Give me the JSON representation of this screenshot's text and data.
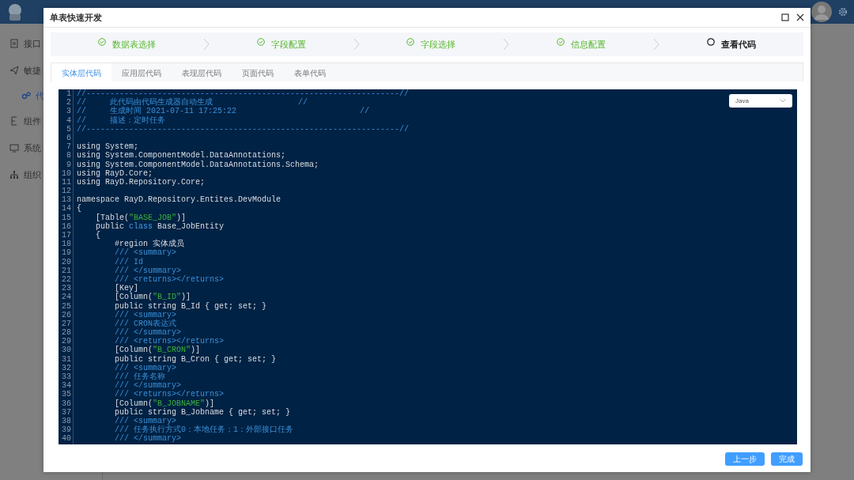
{
  "sidebar": {
    "items": [
      {
        "label": "接口",
        "kind": "top",
        "selected": false
      },
      {
        "label": "敏捷",
        "kind": "top",
        "selected": false
      },
      {
        "label": "代",
        "kind": "sub",
        "selected": true
      },
      {
        "label": "组件",
        "kind": "top",
        "selected": false
      },
      {
        "label": "系统",
        "kind": "top",
        "selected": false
      },
      {
        "label": "组织",
        "kind": "top",
        "selected": false
      }
    ]
  },
  "dialog": {
    "title": "单表快速开发",
    "steps": [
      {
        "label": "数据表选择",
        "done": true
      },
      {
        "label": "字段配置",
        "done": true
      },
      {
        "label": "字段选择",
        "done": true
      },
      {
        "label": "信息配置",
        "done": true
      },
      {
        "label": "查看代码",
        "done": false
      }
    ],
    "tabs": [
      {
        "label": "实体层代码",
        "selected": true
      },
      {
        "label": "应用层代码",
        "selected": false
      },
      {
        "label": "表现层代码",
        "selected": false
      },
      {
        "label": "页面代码",
        "selected": false
      },
      {
        "label": "表单代码",
        "selected": false
      }
    ],
    "language_select": {
      "value": "Java"
    },
    "code_lines": [
      {
        "number": "1",
        "tokens": [
          {
            "kind": "comment",
            "text": "//------------------------------------------------------------------//"
          }
        ]
      },
      {
        "number": "2",
        "tokens": [
          {
            "kind": "comment",
            "text": "//     此代码由代码生成器自动生成                  //"
          }
        ]
      },
      {
        "number": "3",
        "tokens": [
          {
            "kind": "comment",
            "text": "//     生成时间 2021-07-11 17:25:22                          //"
          }
        ]
      },
      {
        "number": "4",
        "tokens": [
          {
            "kind": "comment",
            "text": "//     描述：定时任务"
          }
        ]
      },
      {
        "number": "5",
        "tokens": [
          {
            "kind": "comment",
            "text": "//------------------------------------------------------------------//"
          }
        ]
      },
      {
        "number": "6"
      },
      {
        "number": "7",
        "tokens": [
          {
            "kind": "code",
            "text": "using System;"
          }
        ]
      },
      {
        "number": "8",
        "tokens": [
          {
            "kind": "code",
            "text": "using System.ComponentModel.DataAnnotations;"
          }
        ]
      },
      {
        "number": "9",
        "tokens": [
          {
            "kind": "code",
            "text": "using System.ComponentModel.DataAnnotations.Schema;"
          }
        ]
      },
      {
        "number": "10",
        "tokens": [
          {
            "kind": "code",
            "text": "using RayD.Core;"
          }
        ]
      },
      {
        "number": "11",
        "tokens": [
          {
            "kind": "code",
            "text": "using RayD.Repository.Core;"
          }
        ]
      },
      {
        "number": "12"
      },
      {
        "number": "13",
        "tokens": [
          {
            "kind": "code",
            "text": "namespace RayD.Repository.Entites.DevModule"
          }
        ]
      },
      {
        "number": "14",
        "tokens": [
          {
            "kind": "code",
            "text": "{"
          }
        ]
      },
      {
        "number": "15",
        "tokens": [
          {
            "kind": "code",
            "text": "    [Table("
          },
          {
            "kind": "string",
            "text": "\"BASE_JOB\""
          },
          {
            "kind": "code",
            "text": ")]"
          }
        ]
      },
      {
        "number": "16",
        "tokens": [
          {
            "kind": "code",
            "text": "    public "
          },
          {
            "kind": "keyword",
            "text": "class"
          },
          {
            "kind": "code",
            "text": " Base_JobEntity"
          }
        ]
      },
      {
        "number": "17",
        "tokens": [
          {
            "kind": "code",
            "text": "    {"
          }
        ]
      },
      {
        "number": "18",
        "tokens": [
          {
            "kind": "code",
            "text": "        #region 实体成员"
          }
        ]
      },
      {
        "number": "19",
        "tokens": [
          {
            "kind": "comment",
            "text": "        /// <summary>"
          }
        ]
      },
      {
        "number": "20",
        "tokens": [
          {
            "kind": "comment",
            "text": "        /// Id"
          }
        ]
      },
      {
        "number": "21",
        "tokens": [
          {
            "kind": "comment",
            "text": "        /// </summary>"
          }
        ]
      },
      {
        "number": "22",
        "tokens": [
          {
            "kind": "comment",
            "text": "        /// <returns></returns>"
          }
        ]
      },
      {
        "number": "23",
        "tokens": [
          {
            "kind": "code",
            "text": "        [Key]"
          }
        ]
      },
      {
        "number": "24",
        "tokens": [
          {
            "kind": "code",
            "text": "        [Column("
          },
          {
            "kind": "string",
            "text": "\"B_ID\""
          },
          {
            "kind": "code",
            "text": ")]"
          }
        ]
      },
      {
        "number": "25",
        "tokens": [
          {
            "kind": "code",
            "text": "        public string B_Id { get; set; }"
          }
        ]
      },
      {
        "number": "26",
        "tokens": [
          {
            "kind": "comment",
            "text": "        /// <summary>"
          }
        ]
      },
      {
        "number": "27",
        "tokens": [
          {
            "kind": "comment",
            "text": "        /// CRON表达式"
          }
        ]
      },
      {
        "number": "28",
        "tokens": [
          {
            "kind": "comment",
            "text": "        /// </summary>"
          }
        ]
      },
      {
        "number": "29",
        "tokens": [
          {
            "kind": "comment",
            "text": "        /// <returns></returns>"
          }
        ]
      },
      {
        "number": "30",
        "tokens": [
          {
            "kind": "code",
            "text": "        [Column("
          },
          {
            "kind": "string",
            "text": "\"B_CRON\""
          },
          {
            "kind": "code",
            "text": ")]"
          }
        ]
      },
      {
        "number": "31",
        "tokens": [
          {
            "kind": "code",
            "text": "        public string B_Cron { get; set; }"
          }
        ]
      },
      {
        "number": "32",
        "tokens": [
          {
            "kind": "comment",
            "text": "        /// <summary>"
          }
        ]
      },
      {
        "number": "33",
        "tokens": [
          {
            "kind": "comment",
            "text": "        /// 任务名称"
          }
        ]
      },
      {
        "number": "34",
        "tokens": [
          {
            "kind": "comment",
            "text": "        /// </summary>"
          }
        ]
      },
      {
        "number": "35",
        "tokens": [
          {
            "kind": "comment",
            "text": "        /// <returns></returns>"
          }
        ]
      },
      {
        "number": "36",
        "tokens": [
          {
            "kind": "code",
            "text": "        [Column("
          },
          {
            "kind": "string",
            "text": "\"B_JOBNAME\""
          },
          {
            "kind": "code",
            "text": ")]"
          }
        ]
      },
      {
        "number": "37",
        "tokens": [
          {
            "kind": "code",
            "text": "        public string B_Jobname { get; set; }"
          }
        ]
      },
      {
        "number": "38",
        "tokens": [
          {
            "kind": "comment",
            "text": "        /// <summary>"
          }
        ]
      },
      {
        "number": "39",
        "tokens": [
          {
            "kind": "comment",
            "text": "        /// 任务执行方式0：本地任务；1：外部接口任务"
          }
        ]
      },
      {
        "number": "40",
        "tokens": [
          {
            "kind": "comment",
            "text": "        /// </summary>"
          }
        ]
      }
    ],
    "buttons": [
      {
        "label": "上一步"
      },
      {
        "label": "完成"
      }
    ]
  }
}
